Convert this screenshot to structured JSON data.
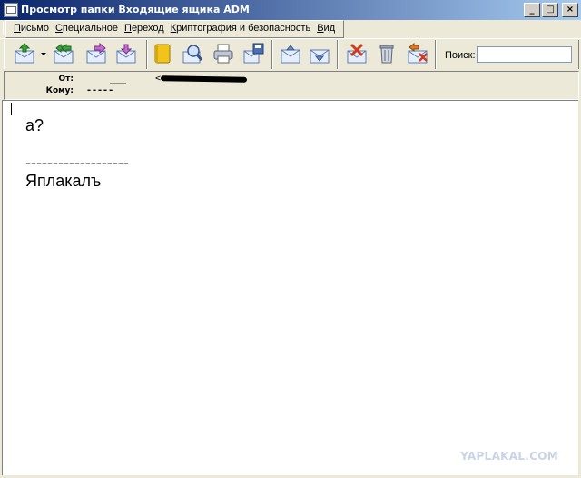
{
  "window": {
    "title": "Просмотр папки Входящие ящика ADM",
    "btn_minimize": "_",
    "btn_maximize": "□",
    "btn_close": "×"
  },
  "menu": {
    "items": [
      {
        "label": "Письмо"
      },
      {
        "label": "Специальное"
      },
      {
        "label": "Переход"
      },
      {
        "label": "Криптография и безопасность"
      },
      {
        "label": "Вид"
      }
    ]
  },
  "toolbar": {
    "buttons": [
      {
        "icon": "get-mail-icon"
      },
      {
        "icon": "reply-all-icon"
      },
      {
        "icon": "forward-icon"
      },
      {
        "icon": "move-mail-icon"
      },
      {
        "icon": "address-book-icon"
      },
      {
        "icon": "find-icon"
      },
      {
        "icon": "print-icon"
      },
      {
        "icon": "save-mail-icon"
      },
      {
        "icon": "previous-mail-icon"
      },
      {
        "icon": "next-mail-icon"
      },
      {
        "icon": "delete-mail-icon"
      },
      {
        "icon": "trash-icon"
      },
      {
        "icon": "delete-reply-icon"
      }
    ],
    "search_label": "Поиск:",
    "search_value": ""
  },
  "header": {
    "from_label": "От:",
    "from_value_prefix": "___",
    "from_value_bracket": "<",
    "to_label": "Кому:",
    "to_value": "-----"
  },
  "message": {
    "line1": "а?",
    "separator": "-------------------",
    "signature": "Яплакалъ"
  },
  "watermark": "YAPLAKAL.COM",
  "colors": {
    "title_start": "#0a246a",
    "title_end": "#a6caf0",
    "chrome": "#ece9d8"
  }
}
